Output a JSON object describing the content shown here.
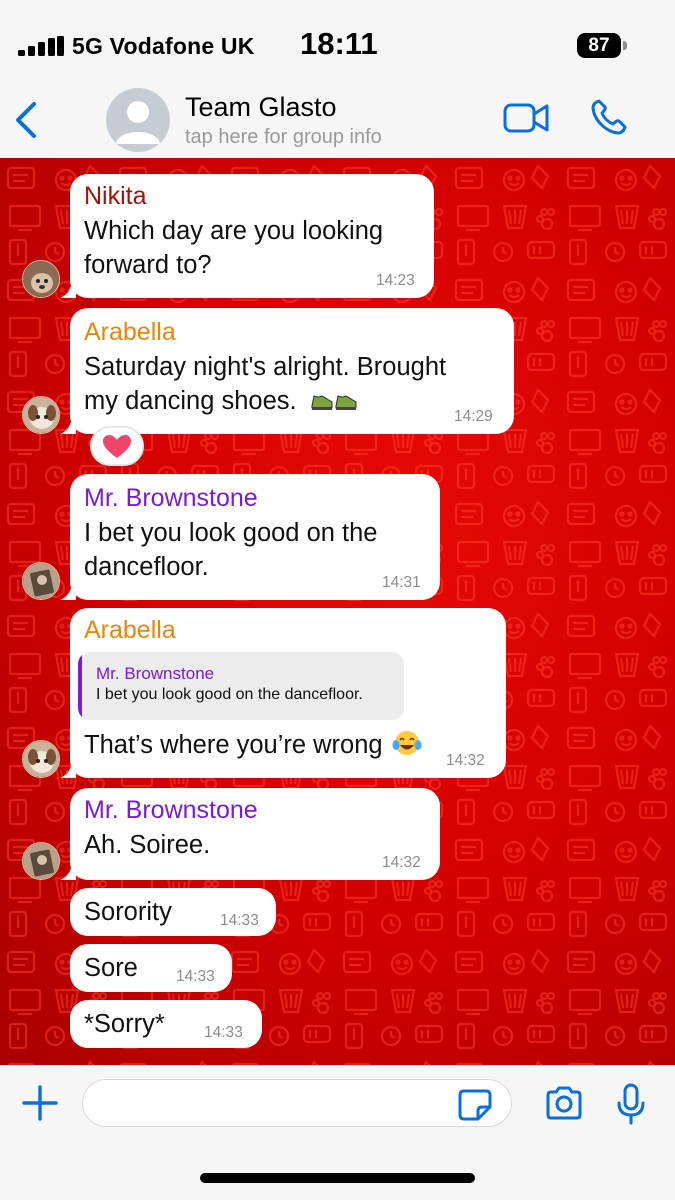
{
  "status_bar": {
    "carrier": "5G  Vodafone UK",
    "time": "18:11",
    "battery": "87"
  },
  "header": {
    "title": "Team Glasto",
    "subtitle": "tap here for group info",
    "back_icon": "chevron-left-icon",
    "video_icon": "video-camera-icon",
    "call_icon": "phone-icon"
  },
  "colors": {
    "accent": "#0a6fd8",
    "chat_background": "#d50000",
    "nikita": "#a0140e",
    "arabella": "#e8860c",
    "brownstone": "#7a1bd7"
  },
  "messages": [
    {
      "sender": "Nikita",
      "text": [
        "Which day are you looking",
        "forward to?"
      ],
      "time": "14:23"
    },
    {
      "sender": "Arabella",
      "text": [
        "Saturday night's alright. Brought",
        "my dancing shoes."
      ],
      "emoji": "sneakers-emoji",
      "time": "14:29",
      "reaction": "heart"
    },
    {
      "sender": "Mr. Brownstone",
      "text": [
        "I bet you look good on the",
        "dancefloor."
      ],
      "time": "14:31"
    },
    {
      "sender": "Arabella",
      "quote": {
        "sender": "Mr. Brownstone",
        "text": "I bet you look good on the dancefloor."
      },
      "text": [
        "That’s where you’re wrong"
      ],
      "emoji": "tears-of-joy-emoji",
      "time": "14:32"
    },
    {
      "sender": "Mr. Brownstone",
      "text": [
        "Ah. Soiree."
      ],
      "time": "14:32"
    },
    {
      "text": [
        "Sorority"
      ],
      "time": "14:33"
    },
    {
      "text": [
        "Sore"
      ],
      "time": "14:33"
    },
    {
      "text": [
        "*Sorry*"
      ],
      "time": "14:33"
    }
  ],
  "composer": {
    "plus_icon": "plus-icon",
    "sticker_icon": "sticker-icon",
    "camera_icon": "camera-icon",
    "mic_icon": "microphone-icon"
  }
}
